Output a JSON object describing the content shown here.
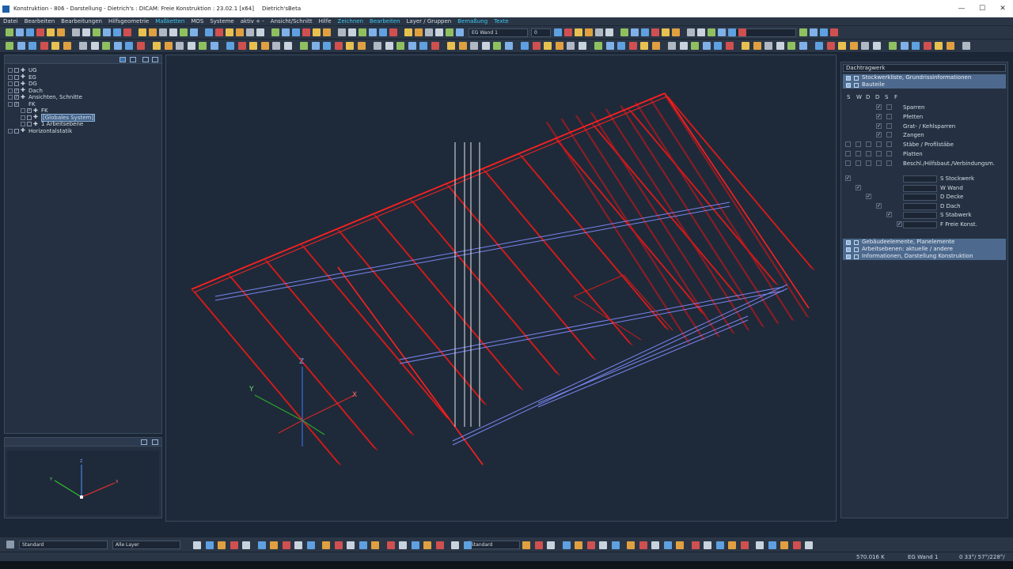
{
  "title": "Konstruktion - 806 - Darstellung - Dietrich's : DICAM: Freie Konstruktion : 23.02.1 [x64]",
  "title_suffix": "Dietrich'sBeta",
  "menu": [
    "Datei",
    "Bearbeiten",
    "Bearbeitungen",
    "Hilfsgeometrie",
    "Maßketten",
    "MOS",
    "Systeme",
    "aktiv + -",
    "Ansicht/Schnitt",
    "Hilfe",
    "Zeichnen",
    "Bearbeiten",
    "Layer / Gruppen",
    "Bemaßung",
    "Texte"
  ],
  "menu_highlight": [
    "Maßketten",
    "Zeichnen",
    "Bearbeiten",
    "Bemaßung",
    "Texte"
  ],
  "toolbar": {
    "wall_combo": "EG Wand 1",
    "num_combo": "0"
  },
  "tree": [
    {
      "label": "UG",
      "icon": "plus-icon"
    },
    {
      "label": "EG",
      "icon": "plus-icon"
    },
    {
      "label": "DG",
      "icon": "plus-icon"
    },
    {
      "label": "Dach",
      "icon": "plus-icon",
      "checked": true
    },
    {
      "label": "Ansichten, Schnitte",
      "icon": "plus-icon",
      "checked": true
    },
    {
      "label": "FK",
      "icon": "",
      "checked": true
    },
    {
      "label": "FK",
      "icon": "plus-icon",
      "checked": true,
      "indent": 1
    },
    {
      "label": "[Globales System]",
      "icon": "plus-icon",
      "indent": 1,
      "selected": true
    },
    {
      "label": "1 Arbeitsebene",
      "icon": "plus-icon",
      "indent": 1
    },
    {
      "label": "Horizontalstatik",
      "icon": "plus-icon"
    }
  ],
  "right": {
    "title": "Dachtragwerk",
    "sections_top": [
      "Stockwerkliste, Grundrissinformationen",
      "Bauteile"
    ],
    "columns": [
      "S",
      "W",
      "D",
      "D",
      "S",
      "F"
    ],
    "bauteile": [
      {
        "label": "Sparren",
        "checked": true
      },
      {
        "label": "Pfetten",
        "checked": true
      },
      {
        "label": "Grat- / Kehlsparren",
        "checked": true
      },
      {
        "label": "Zangen",
        "checked": true
      },
      {
        "label": "Stäbe / Profilstäbe",
        "checked": false
      },
      {
        "label": "Platten",
        "checked": false
      },
      {
        "label": "Beschl./Hilfsbaut./Verbindungsm.",
        "checked": false
      }
    ],
    "floors": [
      "S Stockwerk",
      "W Wand",
      "D Decke",
      "D Dach",
      "S Stabwerk",
      "F Freie Konst."
    ],
    "sections_bottom": [
      "Gebäudeelemente, Planelemente",
      "Arbeitsebenen: aktuelle / andere",
      "Informationen, Darstellung Konstruktion"
    ]
  },
  "axes": {
    "x": "X",
    "y": "Y",
    "z": "Z"
  },
  "statusbar": {
    "style1": "Standard",
    "layer": "Alle Layer",
    "style2": "Standard"
  },
  "bottom": {
    "coord": "570.016 K",
    "wall": "EG Wand 1",
    "angle": "0 33°/ 57°/228°/"
  }
}
